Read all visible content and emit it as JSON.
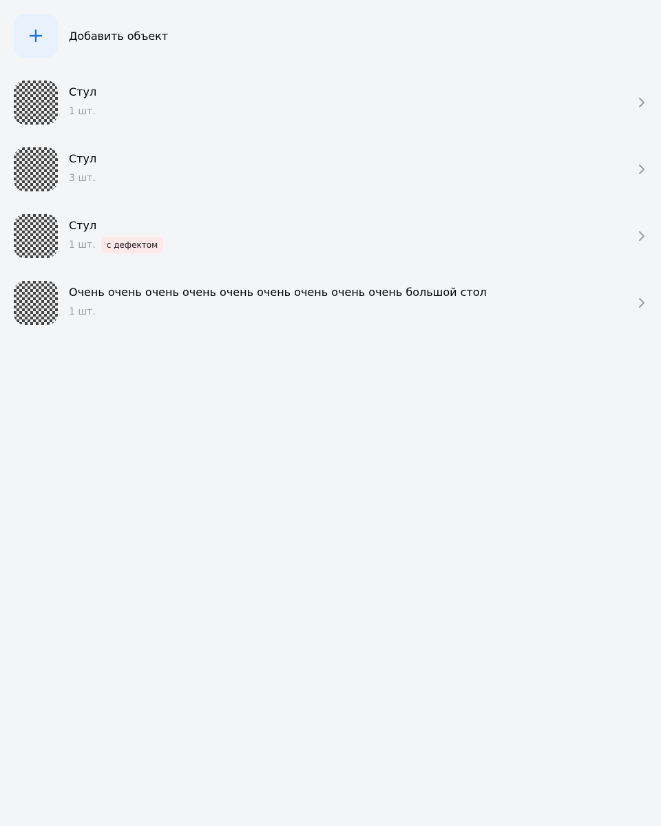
{
  "add_object": {
    "label": "Добавить объект",
    "icon": "plus-icon",
    "accent_color": "#1d74e0"
  },
  "items": [
    {
      "title": "Стул",
      "quantity": "1 шт.",
      "badge": ""
    },
    {
      "title": "Стул",
      "quantity": "3 шт.",
      "badge": ""
    },
    {
      "title": "Стул",
      "quantity": "1 шт.",
      "badge": "с дефектом"
    },
    {
      "title": "Очень очень очень очень очень очень очень очень очень большой стол",
      "quantity": "1 шт.",
      "badge": ""
    }
  ]
}
